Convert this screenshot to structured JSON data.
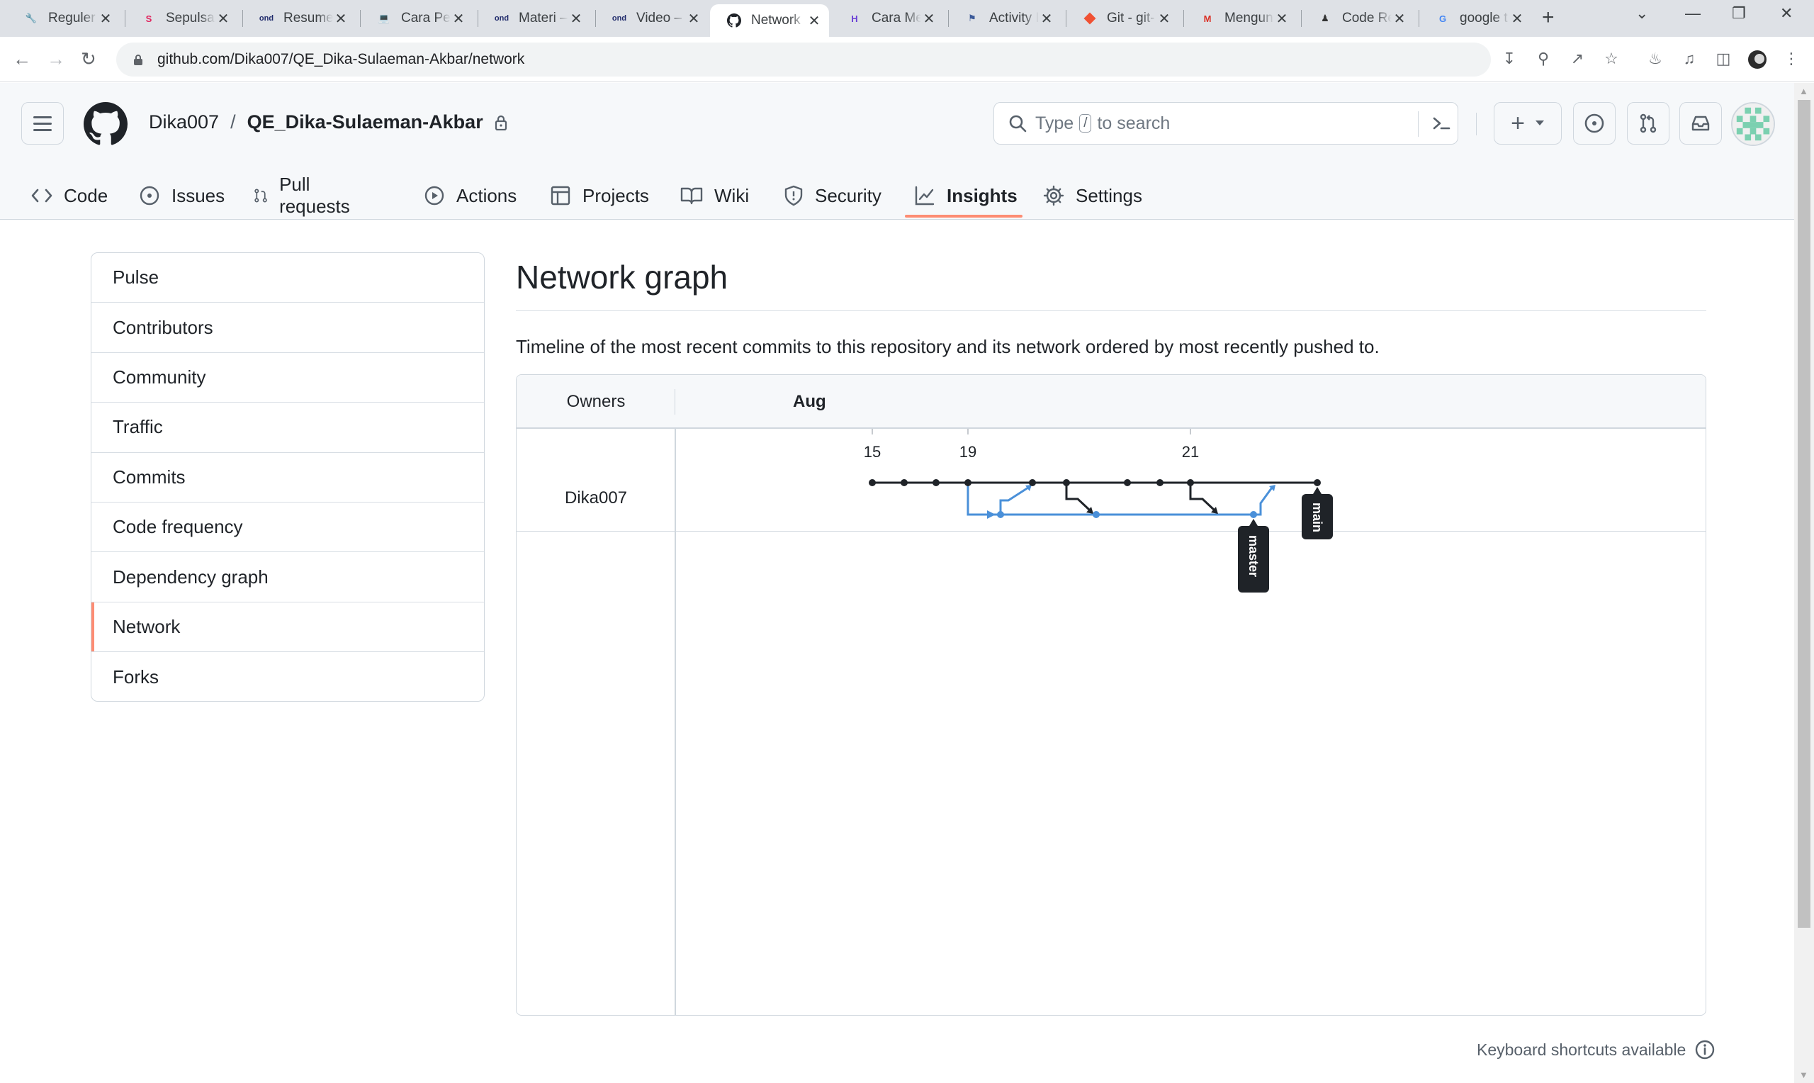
{
  "browser": {
    "tabs": [
      {
        "title": "Reguler",
        "favicon": "wrench-icon"
      },
      {
        "title": "Sepulsa",
        "favicon": "sepulsa-icon"
      },
      {
        "title": "Resume",
        "favicon": "ond-icon"
      },
      {
        "title": "Cara Pen",
        "favicon": "laptop-icon"
      },
      {
        "title": "Materi –",
        "favicon": "ond-icon"
      },
      {
        "title": "Video – ",
        "favicon": "ond-icon"
      },
      {
        "title": "Network",
        "favicon": "github-icon"
      },
      {
        "title": "Cara Me",
        "favicon": "h-icon"
      },
      {
        "title": "Activity I",
        "favicon": "flag-icon"
      },
      {
        "title": "Git - git-",
        "favicon": "git-icon"
      },
      {
        "title": "Mengun",
        "favicon": "gmail-icon"
      },
      {
        "title": "Code Re",
        "favicon": "person-icon"
      },
      {
        "title": "google t",
        "favicon": "google-icon"
      }
    ],
    "active_tab": 6,
    "url": "github.com/Dika007/QE_Dika-Sulaeman-Akbar/network"
  },
  "header": {
    "owner": "Dika007",
    "separator": "/",
    "repo": "QE_Dika-Sulaeman-Akbar",
    "search_before": "Type",
    "search_key": "/",
    "search_after": "to search",
    "plus_label": "+"
  },
  "repo_nav": [
    {
      "label": "Code",
      "icon": "code-icon"
    },
    {
      "label": "Issues",
      "icon": "issue-icon"
    },
    {
      "label": "Pull requests",
      "icon": "pull-request-icon"
    },
    {
      "label": "Actions",
      "icon": "play-icon"
    },
    {
      "label": "Projects",
      "icon": "table-icon"
    },
    {
      "label": "Wiki",
      "icon": "book-icon"
    },
    {
      "label": "Security",
      "icon": "shield-icon"
    },
    {
      "label": "Insights",
      "icon": "graph-icon"
    },
    {
      "label": "Settings",
      "icon": "gear-icon"
    }
  ],
  "active_nav": "Insights",
  "sidebar": {
    "items": [
      "Pulse",
      "Contributors",
      "Community",
      "Traffic",
      "Commits",
      "Code frequency",
      "Dependency graph",
      "Network",
      "Forks"
    ],
    "selected": "Network"
  },
  "main": {
    "title": "Network graph",
    "description": "Timeline of the most recent commits to this repository and its network ordered by most recently pushed to."
  },
  "network": {
    "owners_header": "Owners",
    "month": "Aug",
    "days": [
      "15",
      "19",
      "21"
    ],
    "owner": "Dika007",
    "branches": [
      "main",
      "master"
    ],
    "colors": {
      "main": "#1f2328",
      "master": "#4a90d9"
    }
  },
  "footer": {
    "keyboard_hint": "Keyboard shortcuts available"
  }
}
